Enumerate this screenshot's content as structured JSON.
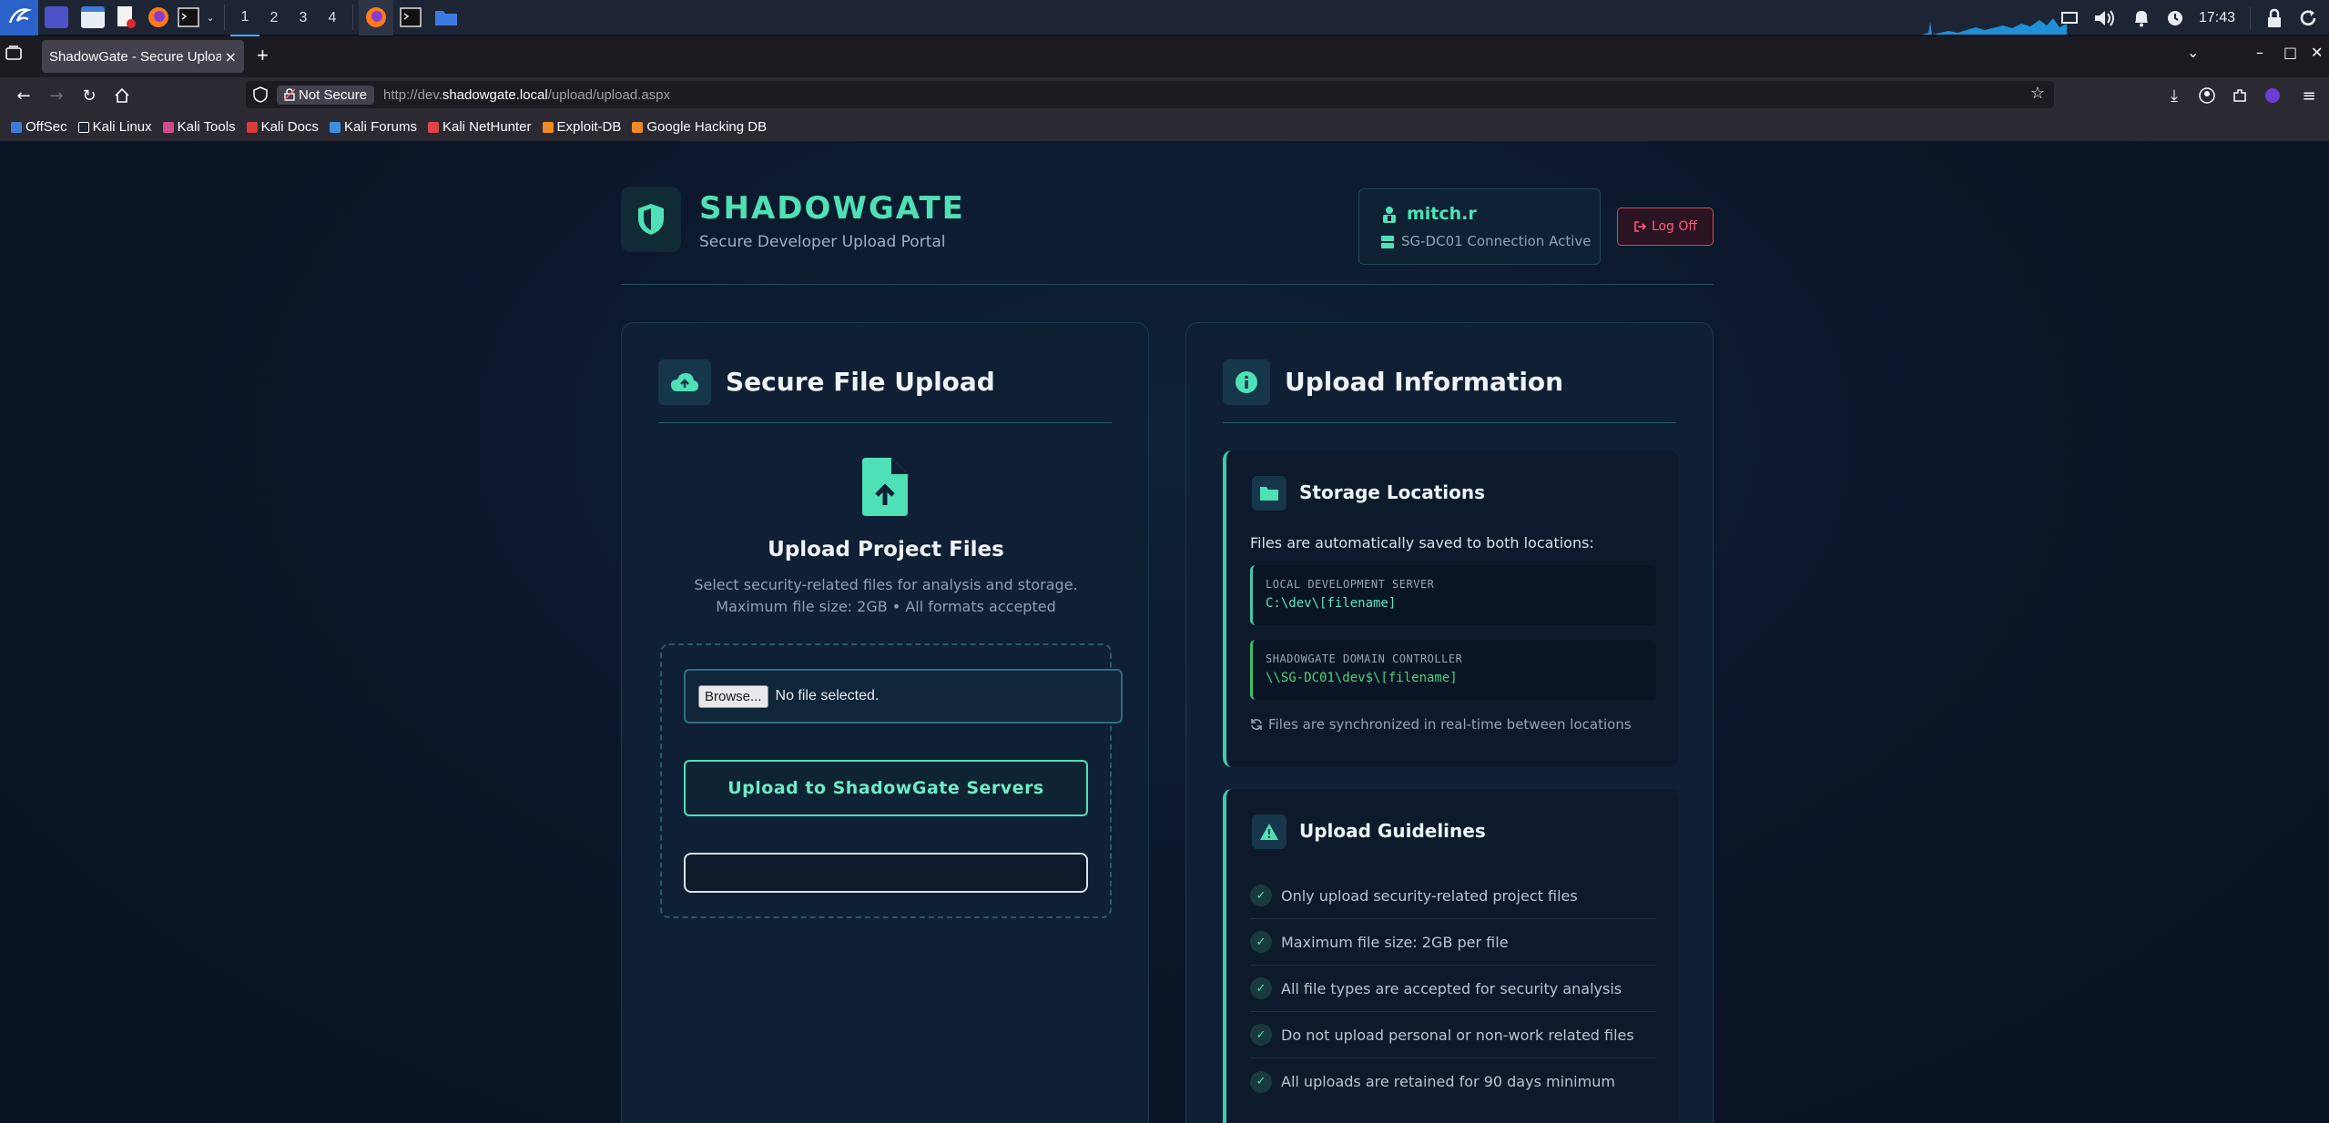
{
  "taskbar": {
    "workspaces": [
      "1",
      "2",
      "3",
      "4"
    ],
    "clock": "17:43",
    "icons": [
      "kali-menu-icon",
      "desktop-icon",
      "file-manager-icon",
      "text-editor-icon",
      "firefox-icon",
      "terminal-icon",
      "chevron-down-icon",
      "firefox-window-icon",
      "terminal-window-icon",
      "folder-window-icon",
      "screen-icon",
      "volume-icon",
      "bell-icon",
      "power-icon",
      "lock-icon",
      "refresh-icon"
    ]
  },
  "browser": {
    "tab_title": "ShadowGate - Secure Upload",
    "tab_close": "×",
    "new_tab": "+",
    "not_secure": "Not Secure",
    "url_prefix": "http://dev.",
    "url_host": "shadowgate.local",
    "url_path": "/upload/upload.aspx",
    "bookmarks": [
      "OffSec",
      "Kali Linux",
      "Kali Tools",
      "Kali Docs",
      "Kali Forums",
      "Kali NetHunter",
      "Exploit-DB",
      "Google Hacking DB"
    ]
  },
  "header": {
    "brand": "SHADOWGATE",
    "tagline": "Secure Developer Upload Portal",
    "user_name": "mitch.r",
    "connection": "SG-DC01 Connection Active",
    "logout_label": "Log Off"
  },
  "upload_card": {
    "title": "Secure File Upload",
    "heading": "Upload Project Files",
    "desc_line1": "Select security-related files for analysis and storage.",
    "desc_line2": "Maximum file size: 2GB • All formats accepted",
    "browse_label": "Browse...",
    "no_file": "No file selected.",
    "upload_button": "Upload to ShadowGate Servers",
    "status": ""
  },
  "info_card": {
    "title": "Upload Information",
    "storage": {
      "title": "Storage Locations",
      "desc": "Files are automatically saved to both locations:",
      "local_label": "LOCAL DEVELOPMENT SERVER",
      "local_path": "C:\\dev\\[filename]",
      "dc_label": "SHADOWGATE DOMAIN CONTROLLER",
      "dc_path": "\\\\SG-DC01\\dev$\\[filename]",
      "sync_note": "Files are synchronized in real-time between locations"
    },
    "guidelines": {
      "title": "Upload Guidelines",
      "items": [
        "Only upload security-related project files",
        "Maximum file size: 2GB per file",
        "All file types are accepted for security analysis",
        "Do not upload personal or non-work related files",
        "All uploads are retained for 90 days minimum"
      ]
    }
  },
  "colors": {
    "accent": "#4fe0b6",
    "danger": "#ff5b7a",
    "bg": "#0b1424"
  }
}
